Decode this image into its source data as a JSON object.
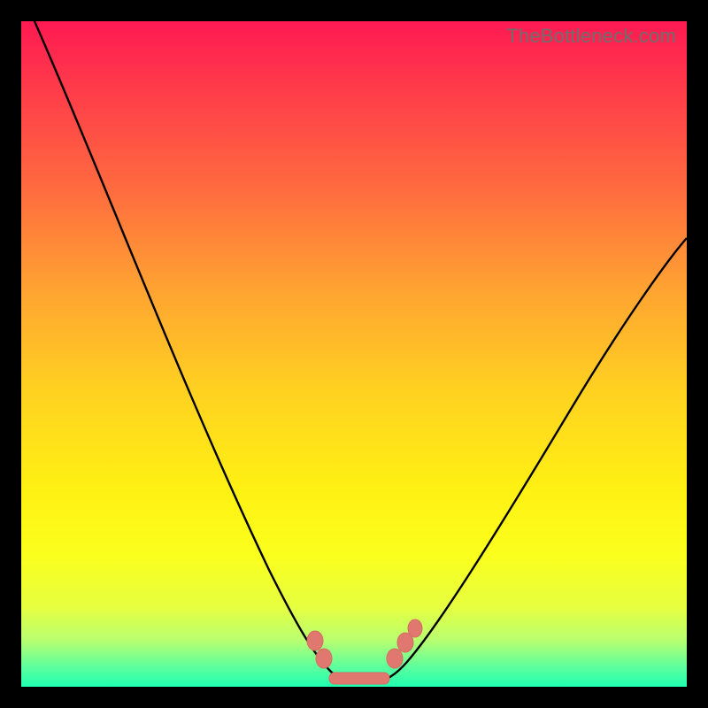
{
  "watermark": "TheBottleneck.com",
  "chart_data": {
    "type": "line",
    "title": "",
    "xlabel": "",
    "ylabel": "",
    "xlim": [
      0,
      100
    ],
    "ylim": [
      0,
      100
    ],
    "series": [
      {
        "name": "bottleneck-curve",
        "x": [
          2,
          10,
          20,
          30,
          37,
          42,
          45,
          47,
          49,
          51,
          53,
          56,
          60,
          66,
          75,
          85,
          95,
          100
        ],
        "y": [
          100,
          82,
          60,
          38,
          22,
          11,
          5,
          2,
          0.5,
          0.5,
          1.5,
          4,
          9,
          18,
          32,
          46,
          58,
          65
        ]
      }
    ],
    "markers": {
      "left_cluster": [
        {
          "x": 44,
          "y": 7
        },
        {
          "x": 45.5,
          "y": 4
        }
      ],
      "right_cluster": [
        {
          "x": 56,
          "y": 4
        },
        {
          "x": 57.5,
          "y": 6.5
        },
        {
          "x": 59,
          "y": 8.5
        }
      ],
      "bottom_bar": {
        "x_start": 46,
        "x_end": 55,
        "y": 0.8
      }
    },
    "gradient_note": "vertical red→orange→yellow→green, minimum (green) at bottom"
  }
}
